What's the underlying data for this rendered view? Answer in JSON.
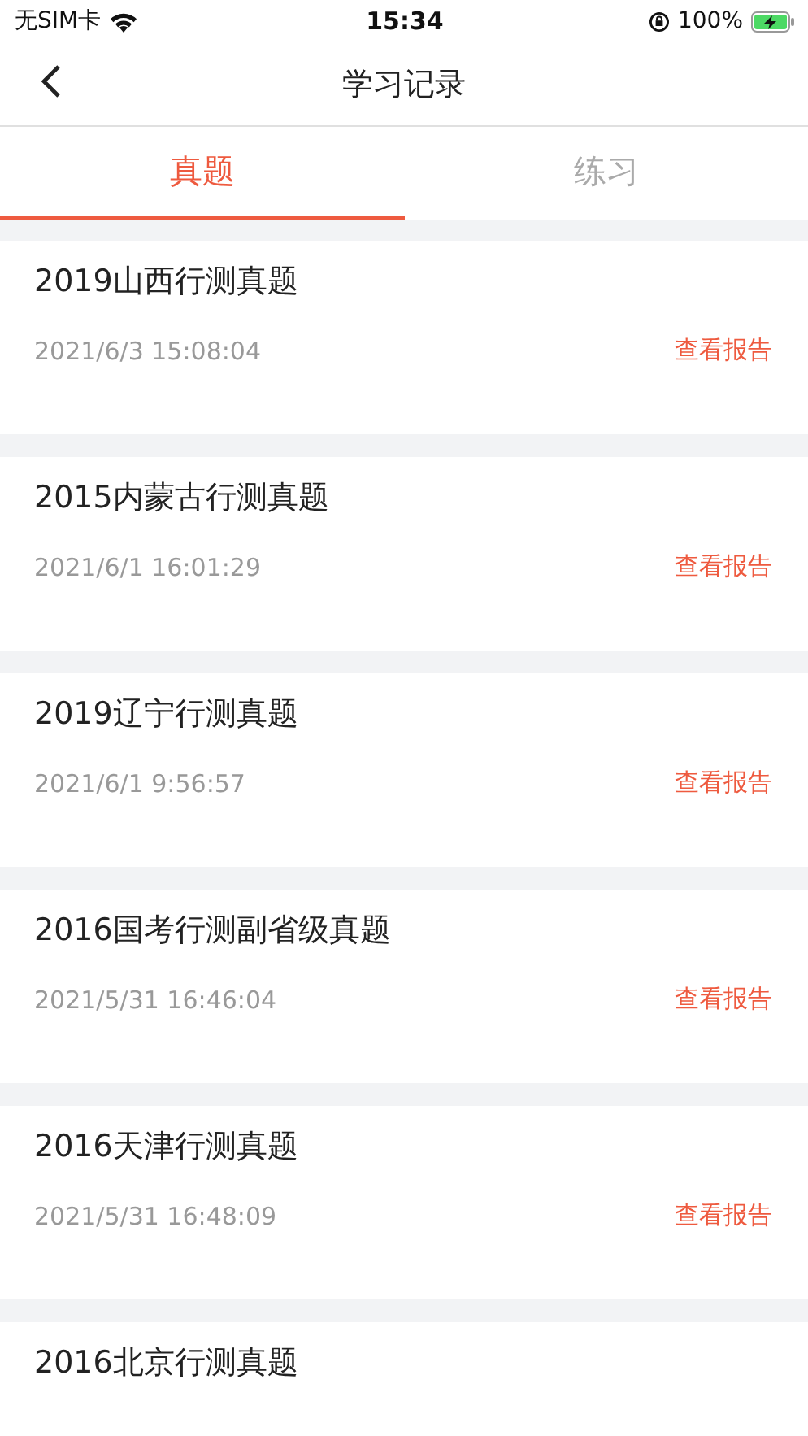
{
  "status_bar": {
    "carrier": "无SIM卡",
    "time": "15:34",
    "battery": "100%"
  },
  "nav": {
    "title": "学习记录"
  },
  "tabs": [
    {
      "label": "真题",
      "selected": true
    },
    {
      "label": "练习",
      "selected": false
    }
  ],
  "records": [
    {
      "title": "2019山西行测真题",
      "time": "2021/6/3 15:08:04",
      "link": "查看报告"
    },
    {
      "title": "2015内蒙古行测真题",
      "time": "2021/6/1 16:01:29",
      "link": "查看报告"
    },
    {
      "title": "2019辽宁行测真题",
      "time": "2021/6/1 9:56:57",
      "link": "查看报告"
    },
    {
      "title": "2016国考行测副省级真题",
      "time": "2021/5/31 16:46:04",
      "link": "查看报告"
    },
    {
      "title": "2016天津行测真题",
      "time": "2021/5/31 16:48:09",
      "link": "查看报告"
    },
    {
      "title": "2016北京行测真题"
    }
  ]
}
